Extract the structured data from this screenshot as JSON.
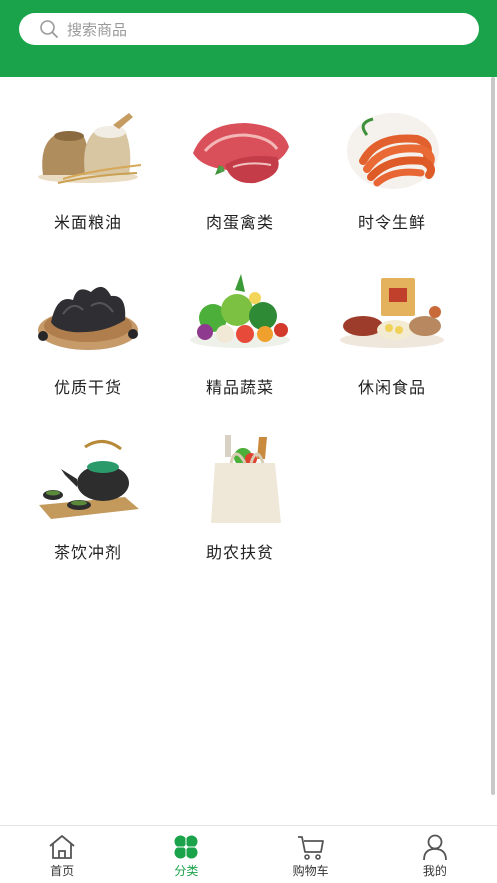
{
  "header": {
    "bg_color": "#1aa34a"
  },
  "search": {
    "placeholder": "搜索商品",
    "icon": "search-icon"
  },
  "categories": [
    {
      "label": "米面粮油",
      "icon": "grain-sacks-image"
    },
    {
      "label": "肉蛋禽类",
      "icon": "meat-image"
    },
    {
      "label": "时令生鲜",
      "icon": "shrimp-image"
    },
    {
      "label": "优质干货",
      "icon": "dried-fungus-image"
    },
    {
      "label": "精品蔬菜",
      "icon": "vegetables-image"
    },
    {
      "label": "休闲食品",
      "icon": "snacks-image"
    },
    {
      "label": "茶饮冲剂",
      "icon": "teapot-image"
    },
    {
      "label": "助农扶贫",
      "icon": "grocery-bag-image"
    }
  ],
  "tabbar": {
    "items": [
      {
        "label": "首页",
        "icon": "home-icon",
        "active": false
      },
      {
        "label": "分类",
        "icon": "category-clover-icon",
        "active": true
      },
      {
        "label": "购物车",
        "icon": "cart-icon",
        "active": false
      },
      {
        "label": "我的",
        "icon": "user-icon",
        "active": false
      }
    ],
    "active_color": "#1aa34a"
  }
}
